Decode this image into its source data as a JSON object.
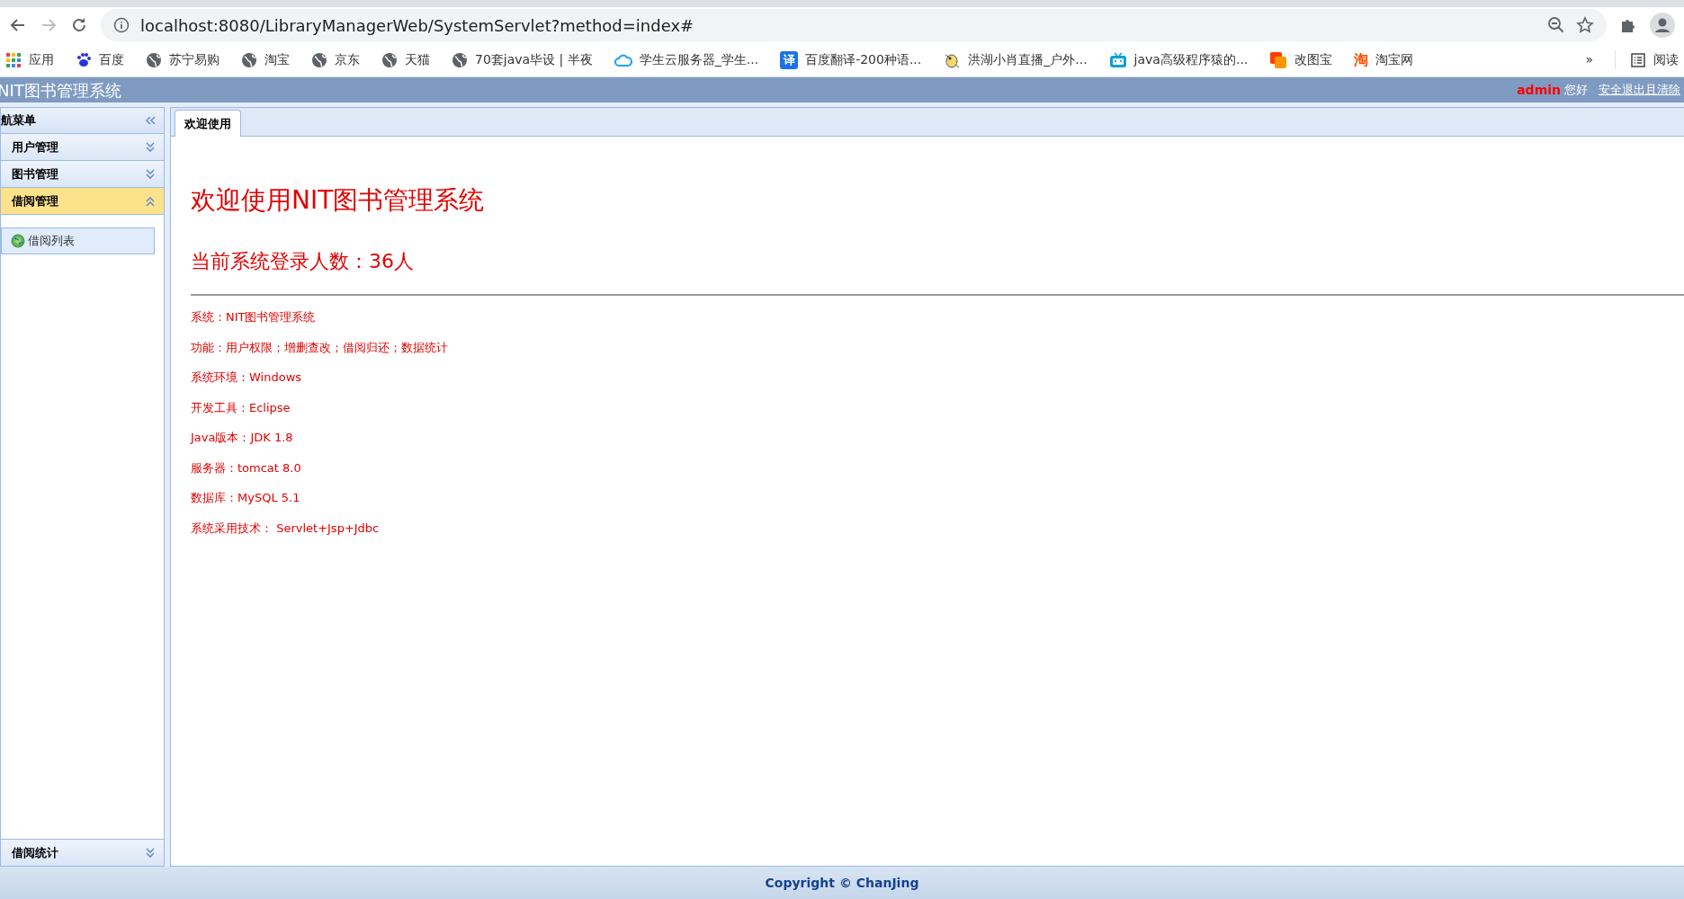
{
  "browser": {
    "url": "localhost:8080/LibraryManagerWeb/SystemServlet?method=index#",
    "forward_disabled": true,
    "bookmarks": [
      {
        "kind": "apps",
        "label": "应用"
      },
      {
        "kind": "paw",
        "label": "百度"
      },
      {
        "kind": "globe",
        "label": "苏宁易购"
      },
      {
        "kind": "globe",
        "label": "淘宝"
      },
      {
        "kind": "globe",
        "label": "京东"
      },
      {
        "kind": "globe",
        "label": "天猫"
      },
      {
        "kind": "globe",
        "label": "70套java毕设 | 半夜"
      },
      {
        "kind": "cloud",
        "label": "学生云服务器_学生..."
      },
      {
        "kind": "badge",
        "icon_text": "译",
        "color": "#1a73e8",
        "label": "百度翻译-200种语..."
      },
      {
        "kind": "bird",
        "label": "洪湖小肖直播_户外..."
      },
      {
        "kind": "tv",
        "label": "java高级程序猿的..."
      },
      {
        "kind": "squares",
        "label": "改图宝"
      },
      {
        "kind": "glyph",
        "icon_text": "淘",
        "color": "#ff5000",
        "label": "淘宝网"
      }
    ],
    "more": "»",
    "reading_list": "阅读"
  },
  "app": {
    "title": "NIT图书管理系统",
    "user": "admin",
    "greeting": "您好",
    "logout": "安全退出且清除"
  },
  "sidebar": {
    "title": "航菜单",
    "panels": [
      {
        "label": "用户管理",
        "expanded": false
      },
      {
        "label": "图书管理",
        "expanded": false
      },
      {
        "label": "借阅管理",
        "expanded": true,
        "children": [
          {
            "label": "借阅列表"
          }
        ]
      }
    ],
    "bottom_panel": {
      "label": "借阅统计",
      "expanded": false
    }
  },
  "tabs": [
    {
      "label": "欢迎使用",
      "selected": true
    }
  ],
  "welcome": {
    "heading": "欢迎使用NIT图书管理系统",
    "online": "当前系统登录人数：36人",
    "lines": [
      "系统：NIT图书管理系统",
      "功能：用户权限；增删查改；借阅归还；数据统计",
      "系统环境：Windows",
      "开发工具：Eclipse",
      "Java版本：JDK 1.8",
      "服务器：tomcat 8.0",
      "数据库：MySQL 5.1",
      "系统采用技术： Servlet+Jsp+Jdbc"
    ]
  },
  "footer": "Copyright © ChanJing"
}
